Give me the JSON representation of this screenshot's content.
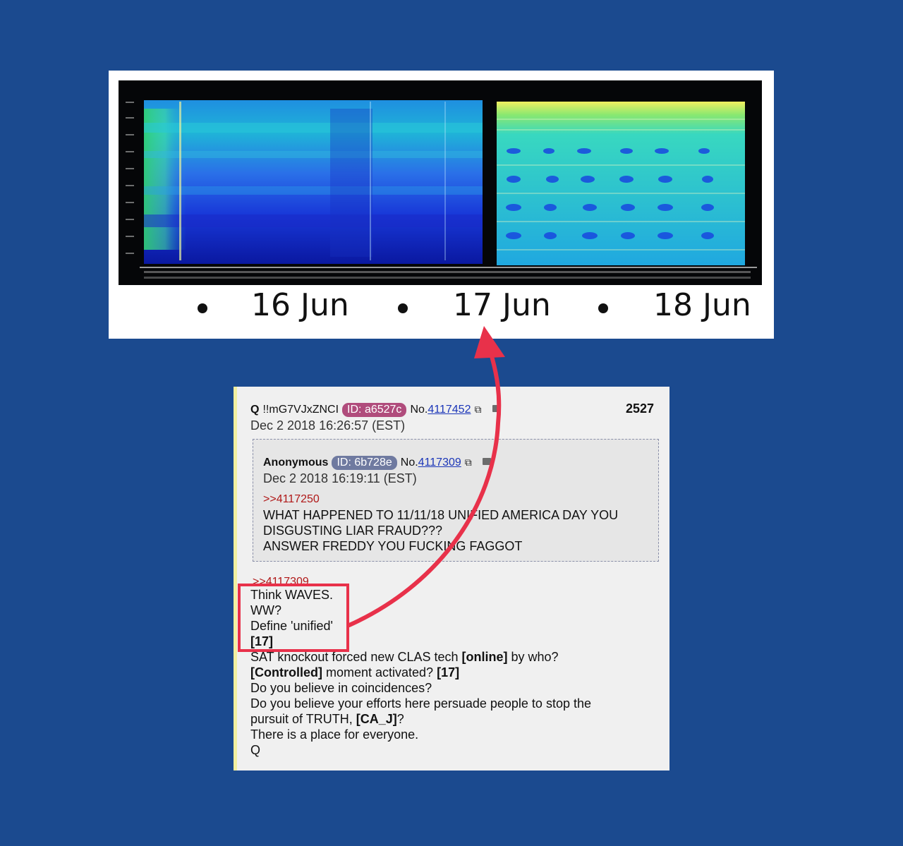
{
  "spectrogram": {
    "dates": [
      "16 Jun",
      "17 Jun",
      "18 Jun"
    ],
    "colors": {
      "background": "#1b4a8f",
      "accent": "#e8314a"
    }
  },
  "post": {
    "poster_name": "Q",
    "tripcode": "!!mG7VJxZNCI",
    "id_badge": "ID: a6527c",
    "no_prefix": "No.",
    "post_number": "4117452",
    "date": "Dec 2 2018 16:26:57 (EST)",
    "count": "2527",
    "quoted": {
      "poster_name": "Anonymous",
      "id_badge": "ID: 6b728e",
      "no_prefix": "No.",
      "post_number": "4117309",
      "date": "Dec 2 2018 16:19:11 (EST)",
      "reply_link": ">>4117250",
      "lines": [
        "WHAT HAPPENED TO 11/11/18 UNIFIED AMERICA DAY YOU",
        "DISGUSTING LIAR FRAUD???",
        "ANSWER FREDDY YOU FUCKING FAGGOT"
      ]
    },
    "reply_link": ">>4117309",
    "body": {
      "l1": "Think WAVES.",
      "l2": "WW?",
      "l3": "Define 'unified'",
      "l4": "[17]",
      "l5a": "SAT knockout forced new CLAS tech ",
      "l5b": "[online]",
      "l5c": " by who?",
      "l6a": "[Controlled]",
      "l6b": " moment activated? ",
      "l6c": "[17]",
      "l7": "Do you believe in coincidences?",
      "l8": "Do you believe your efforts here persuade people to stop the",
      "l9a": "pursuit of TRUTH, ",
      "l9b": "[CA_J]",
      "l9c": "?",
      "l10": "There is a place for everyone.",
      "l11": "Q"
    }
  }
}
